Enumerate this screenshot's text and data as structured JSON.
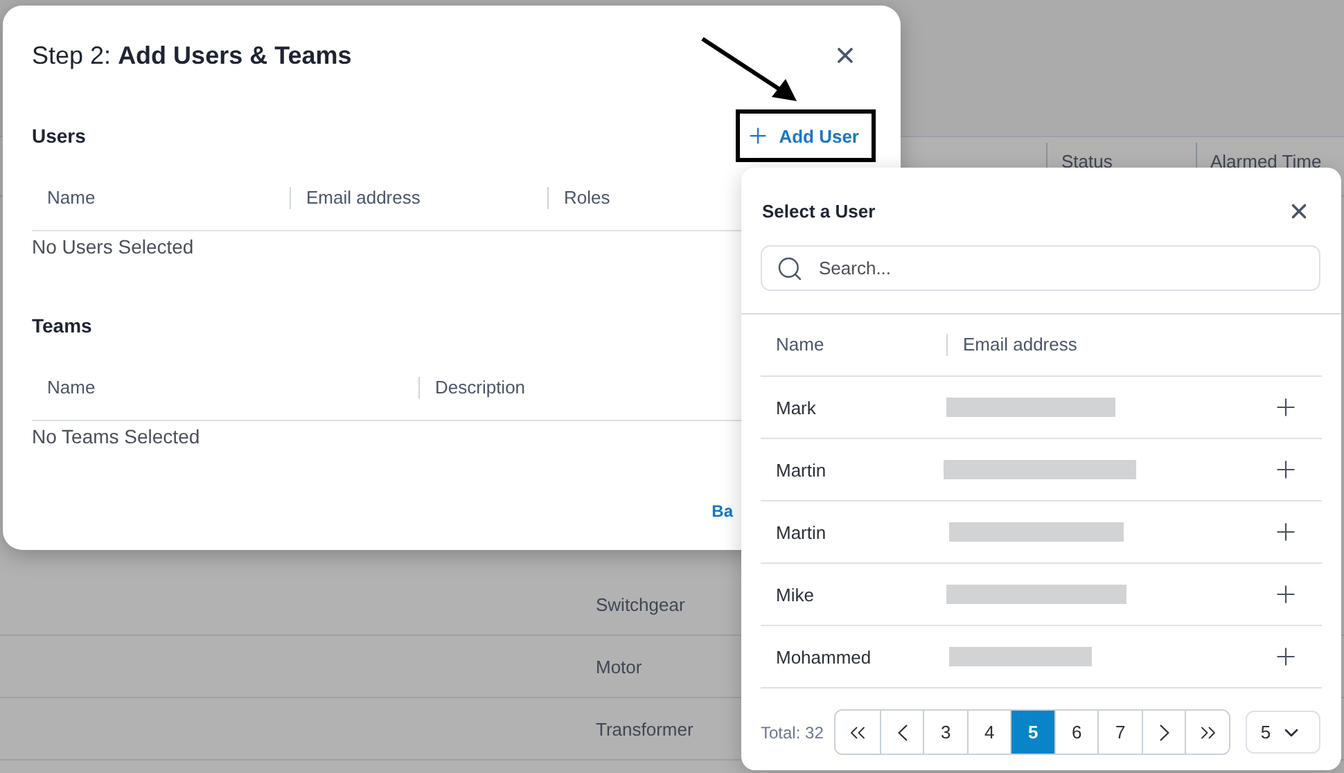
{
  "background": {
    "columns": [
      "Status",
      "Alarmed Time"
    ],
    "rows": [
      "Switchgear",
      "Motor",
      "Transformer"
    ]
  },
  "dialog": {
    "title_prefix": "Step 2:",
    "title": "Add Users & Teams",
    "users": {
      "heading": "Users",
      "add_button": "Add User",
      "columns": [
        "Name",
        "Email address",
        "Roles"
      ],
      "empty": "No Users Selected"
    },
    "teams": {
      "heading": "Teams",
      "columns": [
        "Name",
        "Description"
      ],
      "empty": "No Teams Selected"
    },
    "back_button": "Ba"
  },
  "picker": {
    "title": "Select a User",
    "search": {
      "placeholder": "Search..."
    },
    "columns": [
      "Name",
      "Email address"
    ],
    "rows": [
      {
        "name": "Mark"
      },
      {
        "name": "Martin"
      },
      {
        "name": "Martin"
      },
      {
        "name": "Mike"
      },
      {
        "name": "Mohammed"
      }
    ],
    "total": "Total: 32",
    "pages": [
      {
        "label": "3",
        "selected": false
      },
      {
        "label": "4",
        "selected": false
      },
      {
        "label": "5",
        "selected": true
      },
      {
        "label": "6",
        "selected": false
      },
      {
        "label": "7",
        "selected": false
      }
    ],
    "page_size": "5"
  }
}
